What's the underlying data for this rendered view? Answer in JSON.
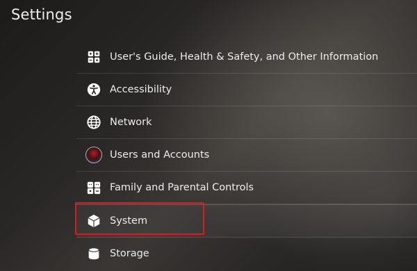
{
  "header": {
    "title": "Settings"
  },
  "menu": {
    "items": [
      {
        "label": "User's Guide, Health & Safety, and Other Information",
        "icon": "guide-icon"
      },
      {
        "label": "Accessibility",
        "icon": "accessibility-icon"
      },
      {
        "label": "Network",
        "icon": "globe-icon"
      },
      {
        "label": "Users and Accounts",
        "icon": "avatar"
      },
      {
        "label": "Family and Parental Controls",
        "icon": "family-icon"
      },
      {
        "label": "System",
        "icon": "cube-icon",
        "selected": true
      },
      {
        "label": "Storage",
        "icon": "storage-icon"
      }
    ]
  },
  "colors": {
    "highlight": "#e0191f",
    "text": "#eeedec"
  }
}
